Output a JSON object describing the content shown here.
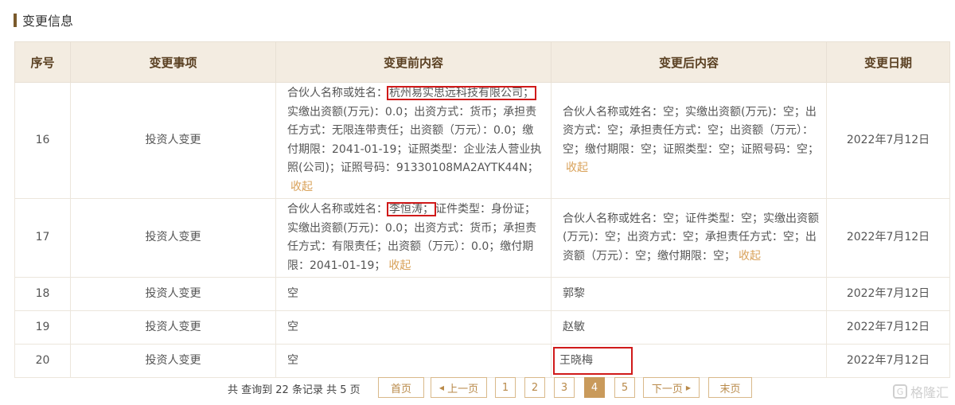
{
  "section": {
    "title": "变更信息"
  },
  "table": {
    "headers": [
      "序号",
      "变更事项",
      "变更前内容",
      "变更后内容",
      "变更日期"
    ],
    "fold_label": "收起",
    "rows": [
      {
        "no": "16",
        "item": "投资人变更",
        "before_prefix": "合伙人名称或姓名：",
        "before_highlight": "杭州易实思远科技有限公司；",
        "before_rest": "实缴出资额(万元)：0.0；出资方式：货币；承担责任方式：无限连带责任；出资额（万元）：0.0；缴付期限：2041-01-19；证照类型：企业法人营业执照(公司)；证照号码：91330108MA2AYTK44N；",
        "after": "合伙人名称或姓名：空；实缴出资额(万元)：空；出资方式：空；承担责任方式：空；出资额（万元）：空；缴付期限：空；证照类型：空；证照号码：空；",
        "date": "2022年7月12日"
      },
      {
        "no": "17",
        "item": "投资人变更",
        "before_prefix": "合伙人名称或姓名：",
        "before_highlight": "李恒涛；",
        "before_rest": "证件类型：身份证；实缴出资额(万元)：0.0；出资方式：货币；承担责任方式：有限责任；出资额（万元）：0.0；缴付期限：2041-01-19；",
        "after": "合伙人名称或姓名：空；证件类型：空；实缴出资额(万元)：空；出资方式：空；承担责任方式：空；出资额（万元）：空；缴付期限：空；",
        "date": "2022年7月12日"
      },
      {
        "no": "18",
        "item": "投资人变更",
        "before": "空",
        "after": "郭黎",
        "date": "2022年7月12日"
      },
      {
        "no": "19",
        "item": "投资人变更",
        "before": "空",
        "after": "赵敏",
        "date": "2022年7月12日"
      },
      {
        "no": "20",
        "item": "投资人变更",
        "before": "空",
        "after": "王晓梅",
        "date": "2022年7月12日"
      }
    ]
  },
  "pager": {
    "info": "共 查询到 22 条记录 共 5 页",
    "first": "首页",
    "prev": "上一页",
    "pages": [
      "1",
      "2",
      "3",
      "4",
      "5"
    ],
    "current_page": "4",
    "next": "下一页",
    "last": "末页",
    "prev_icon": "caret-left-icon",
    "next_icon": "caret-right-icon"
  },
  "watermark": {
    "text": "格隆汇",
    "logo_glyph": "G"
  },
  "colors": {
    "accent": "#c99a5b",
    "header_bg": "#f3ece1",
    "fold_link": "#d9a25a",
    "highlight_box": "#d01a1a"
  }
}
